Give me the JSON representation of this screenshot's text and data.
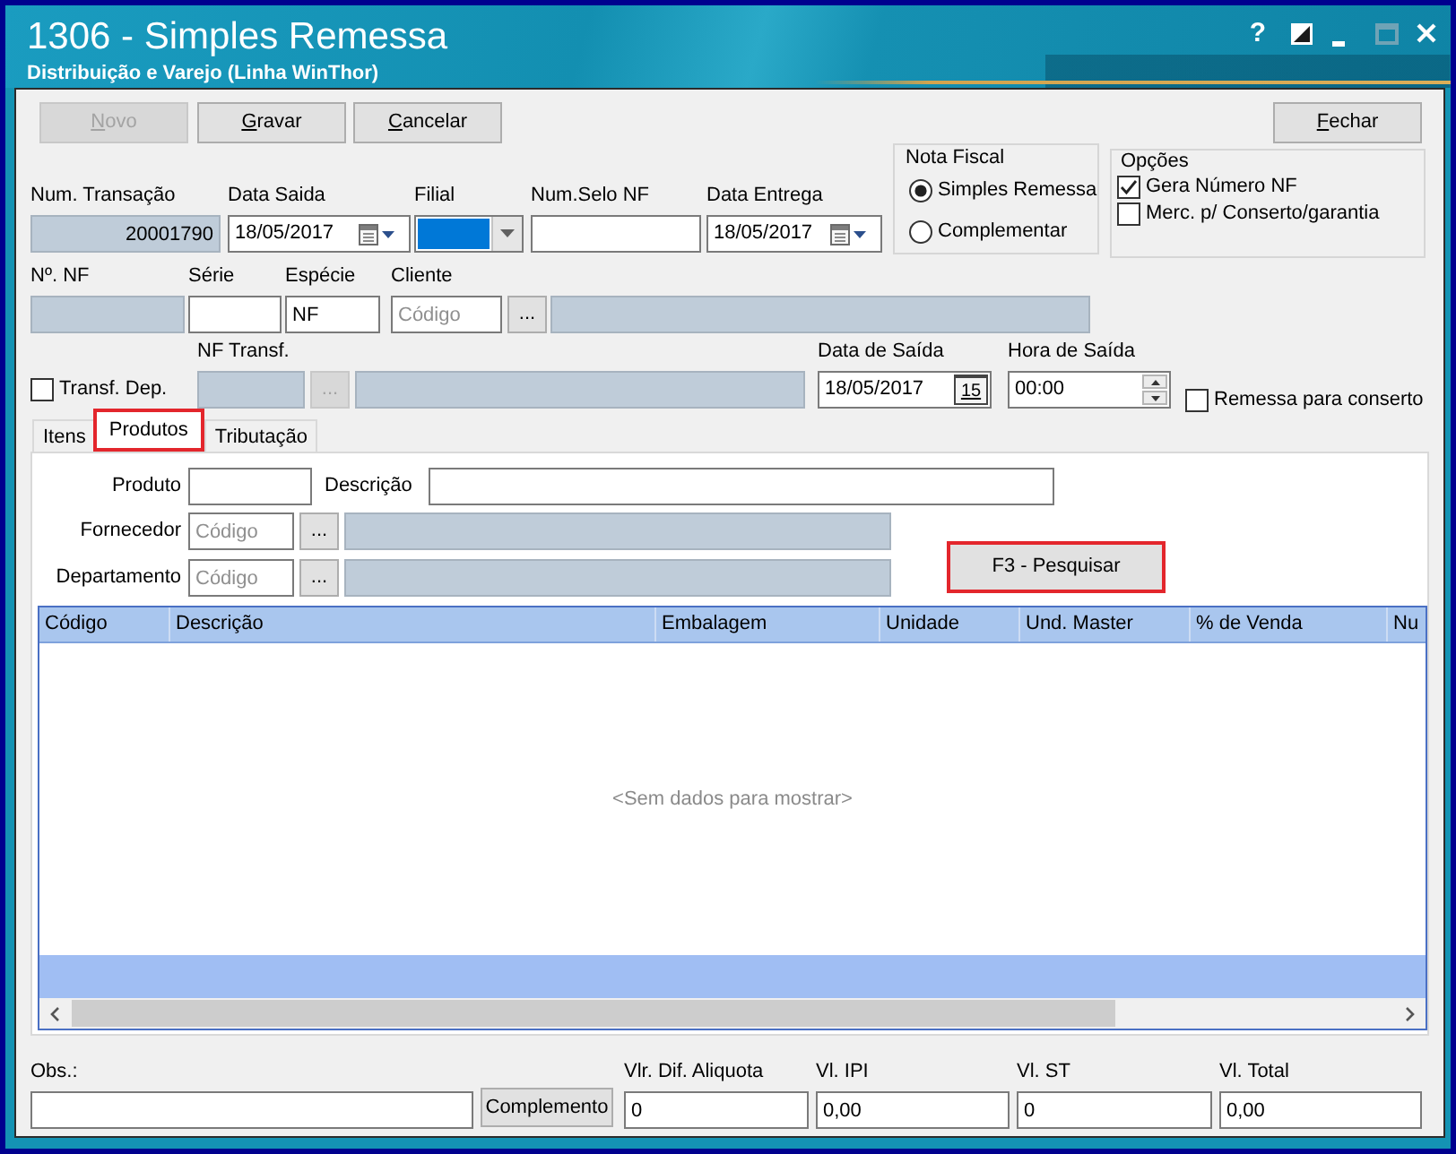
{
  "window": {
    "title": "1306 - Simples Remessa",
    "subtitle": "Distribuição e Varejo (Linha WinThor)",
    "controls": [
      {
        "kind": "help",
        "label": "?",
        "disabled": false
      },
      {
        "kind": "theme",
        "disabled": false
      },
      {
        "kind": "minimize",
        "disabled": false
      },
      {
        "kind": "maximize",
        "disabled": true
      },
      {
        "kind": "close",
        "disabled": false
      }
    ]
  },
  "toolbar": [
    {
      "label": "Novo",
      "disabled": true
    },
    {
      "label": "Gravar",
      "disabled": false
    },
    {
      "label": "Cancelar",
      "disabled": false
    },
    {
      "label": "Fechar",
      "disabled": false
    }
  ],
  "nota_fiscal": {
    "title": "Nota Fiscal",
    "options": [
      {
        "label": "Simples Remessa",
        "selected": true
      },
      {
        "label": "Complementar",
        "selected": false
      }
    ]
  },
  "opcoes": {
    "title": "Opções",
    "options": [
      {
        "label": "Gera Número NF",
        "checked": true
      },
      {
        "label": "Merc. p/ Conserto/garantia",
        "checked": false
      }
    ]
  },
  "row_1": [
    {
      "kind": "number",
      "label": "Num. Transação",
      "value": "20001790",
      "readonly": true
    },
    {
      "kind": "date",
      "label": "Data Saida",
      "value": "18/05/2017"
    },
    {
      "kind": "combo",
      "label": "Filial",
      "focused": true
    },
    {
      "kind": "text",
      "label": "Num.Selo NF",
      "readonly": false
    },
    {
      "kind": "date",
      "label": "Data Entrega",
      "value": "18/05/2017"
    }
  ],
  "row_2": [
    {
      "kind": "text",
      "label": "Nº. NF",
      "readonly": true
    },
    {
      "kind": "text",
      "label": "Série",
      "readonly": false
    },
    {
      "kind": "text",
      "label": "Espécie",
      "value": "NF",
      "readonly": false
    },
    {
      "kind": "lookup",
      "label": "Cliente",
      "placeholder": "Código",
      "button": "...",
      "disabled": false
    }
  ],
  "row_3": [
    {
      "kind": "checkbox",
      "label": "Transf. Dep.",
      "checked": false
    },
    {
      "kind": "lookup",
      "label": "NF Transf.",
      "button": "...",
      "disabled": true
    },
    {
      "kind": "date_picker",
      "label": "Data de Saída",
      "value": "18/05/2017",
      "button": "15"
    },
    {
      "kind": "time",
      "label": "Hora de Saída",
      "value": "00:00"
    },
    {
      "kind": "checkbox",
      "label": "Remessa para conserto",
      "checked": false
    }
  ],
  "tabs": [
    {
      "label": "Itens",
      "selected": false,
      "highlighted": false
    },
    {
      "label": "Produtos",
      "selected": true,
      "highlighted": true
    },
    {
      "label": "Tributação",
      "selected": false,
      "highlighted": false
    }
  ],
  "filters": [
    {
      "kind": "text",
      "label": "Produto"
    },
    {
      "kind": "text",
      "label": "Descrição"
    },
    {
      "kind": "lookup",
      "label": "Fornecedor",
      "placeholder": "Código",
      "button": "..."
    },
    {
      "kind": "lookup",
      "label": "Departamento",
      "placeholder": "Código",
      "button": "..."
    }
  ],
  "search_button": {
    "label": "F3 - Pesquisar",
    "highlighted": true
  },
  "grid": {
    "columns": [
      "Código",
      "Descrição",
      "Embalagem",
      "Unidade",
      "Und. Master",
      "% de Venda",
      "Nu"
    ],
    "empty_text": "<Sem dados para mostrar>"
  },
  "footer": {
    "obs": {
      "label": "Obs.:"
    },
    "complement_button": "Complemento",
    "totals": [
      {
        "label": "Vlr. Dif. Aliquota",
        "value": "0"
      },
      {
        "label": "Vl. IPI",
        "value": "0,00"
      },
      {
        "label": "Vl. ST",
        "value": "0"
      },
      {
        "label": "Vl. Total",
        "value": "0,00"
      }
    ]
  }
}
